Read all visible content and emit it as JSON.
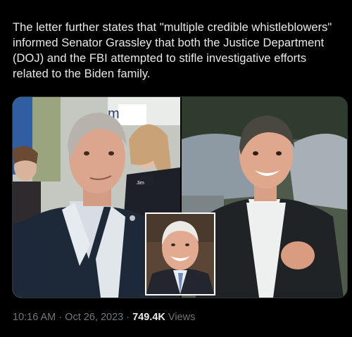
{
  "tweet": {
    "text": "The letter further states that \"multiple credible whistleblowers\" informed Senator Grassley that both the Justice Department (DOJ) and the FBI attempted to stifle investigative efforts related to the Biden family."
  },
  "media": {
    "left_photo_sign": "Jim",
    "left_photo_partial_text": "m"
  },
  "meta": {
    "time": "10:16 AM",
    "separator_1": "·",
    "date": "Oct 26, 2023",
    "separator_2": "·",
    "views_count": "749.4K",
    "views_label": "Views"
  },
  "colors": {
    "background": "#000000",
    "text_primary": "#e7e9ea",
    "text_secondary": "#71767b"
  }
}
